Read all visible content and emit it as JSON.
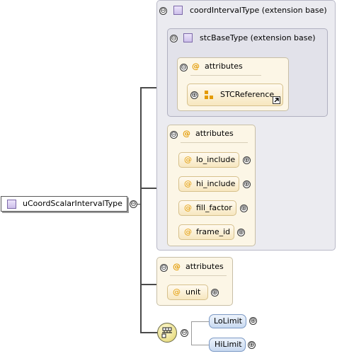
{
  "root": {
    "label": "uCoordScalarIntervalType",
    "toggle": "⊖"
  },
  "base_type": {
    "label": "coordIntervalType (extension base)",
    "toggle": "⊖"
  },
  "inner_base_type": {
    "label": "stcBaseType (extension base)",
    "toggle": "⊖"
  },
  "inner_attributes": {
    "label": "attributes",
    "at": "@",
    "toggle": "⊖",
    "items": [
      {
        "label": "STCReference",
        "expand": "⊕"
      }
    ]
  },
  "coord_attributes": {
    "label": "attributes",
    "at": "@",
    "toggle": "⊖",
    "items": [
      {
        "label": "lo_include",
        "expand": "⊕"
      },
      {
        "label": "hi_include",
        "expand": "⊕"
      },
      {
        "label": "fill_factor",
        "expand": "⊕"
      },
      {
        "label": "frame_id",
        "expand": "⊕"
      }
    ]
  },
  "own_attributes": {
    "label": "attributes",
    "at": "@",
    "toggle": "⊖",
    "items": [
      {
        "label": "unit",
        "expand": "⊕"
      }
    ]
  },
  "sequence": {
    "toggle": "⊖",
    "elements": [
      {
        "label": "LoLimit",
        "expand": "⊕"
      },
      {
        "label": "HiLimit",
        "expand": "⊕"
      }
    ]
  },
  "colors": {
    "connector": "#4a4a4a",
    "attribute_at": "#e39a00",
    "element_pill": "#c8d9f0"
  }
}
